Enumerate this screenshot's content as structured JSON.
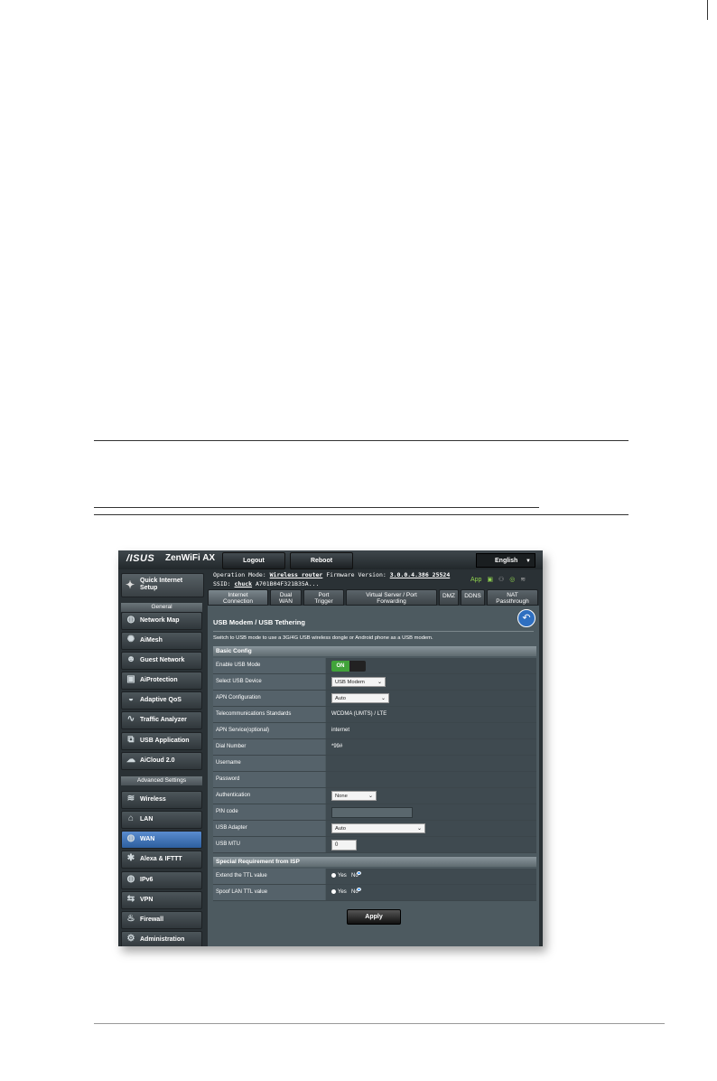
{
  "topbar": {
    "brand": "/ISUS",
    "model": "ZenWiFi AX",
    "logout": "Logout",
    "reboot": "Reboot",
    "language": "English"
  },
  "status": {
    "op_label": "Operation Mode:",
    "op_value": "Wireless router",
    "fw_label": "Firmware Version:",
    "fw_value": "3.0.0.4.386_25524",
    "ssid_label": "SSID:",
    "ssid_value": "chuck",
    "ssid_extra": "A701B04F321B35A...",
    "app_label": "App"
  },
  "sidebar": {
    "qis_line1": "Quick Internet",
    "qis_line2": "Setup",
    "general": "General",
    "general_items": [
      "Network Map",
      "AiMesh",
      "Guest Network",
      "AiProtection",
      "Adaptive QoS",
      "Traffic Analyzer",
      "USB Application",
      "AiCloud 2.0"
    ],
    "advanced": "Advanced Settings",
    "advanced_items": [
      "Wireless",
      "LAN",
      "WAN",
      "Alexa & IFTTT",
      "IPv6",
      "VPN",
      "Firewall",
      "Administration"
    ]
  },
  "tabs": [
    {
      "l1": "Internet",
      "l2": "Connection"
    },
    {
      "l1": "Dual",
      "l2": "WAN"
    },
    {
      "l1": "Port",
      "l2": "Trigger"
    },
    {
      "l1": "Virtual Server / Port",
      "l2": "Forwarding"
    },
    {
      "l1": "DMZ",
      "l2": ""
    },
    {
      "l1": "DDNS",
      "l2": ""
    },
    {
      "l1": "NAT",
      "l2": "Passthrough"
    }
  ],
  "content": {
    "title": "USB Modem / USB Tethering",
    "description": "Switch to USB mode to use a 3G/4G USB wireless dongle or Android phone as a USB modem.",
    "basic_config": "Basic Config",
    "rows": {
      "enable_usb": {
        "label": "Enable USB Mode",
        "value": "ON"
      },
      "select_device": {
        "label": "Select USB Device",
        "value": "USB Modem"
      },
      "apn_config": {
        "label": "APN Configuration",
        "value": "Auto"
      },
      "telecom": {
        "label": "Telecommunications Standards",
        "value": "WCDMA (UMTS) / LTE"
      },
      "apn_service": {
        "label": "APN Service(optional)",
        "value": "internet"
      },
      "dial": {
        "label": "Dial Number",
        "value": "*99#"
      },
      "username": {
        "label": "Username",
        "value": ""
      },
      "password": {
        "label": "Password",
        "value": ""
      },
      "auth": {
        "label": "Authentication",
        "value": "None"
      },
      "pin": {
        "label": "PIN code",
        "value": ""
      },
      "adapter": {
        "label": "USB Adapter",
        "value": "Auto"
      },
      "mtu": {
        "label": "USB MTU",
        "value": "0"
      }
    },
    "special": "Special Requirement from ISP",
    "ttl": {
      "label": "Extend the TTL value",
      "yes": "Yes",
      "no": "No"
    },
    "spoof": {
      "label": "Spoof LAN TTL value",
      "yes": "Yes",
      "no": "No"
    },
    "apply": "Apply"
  }
}
